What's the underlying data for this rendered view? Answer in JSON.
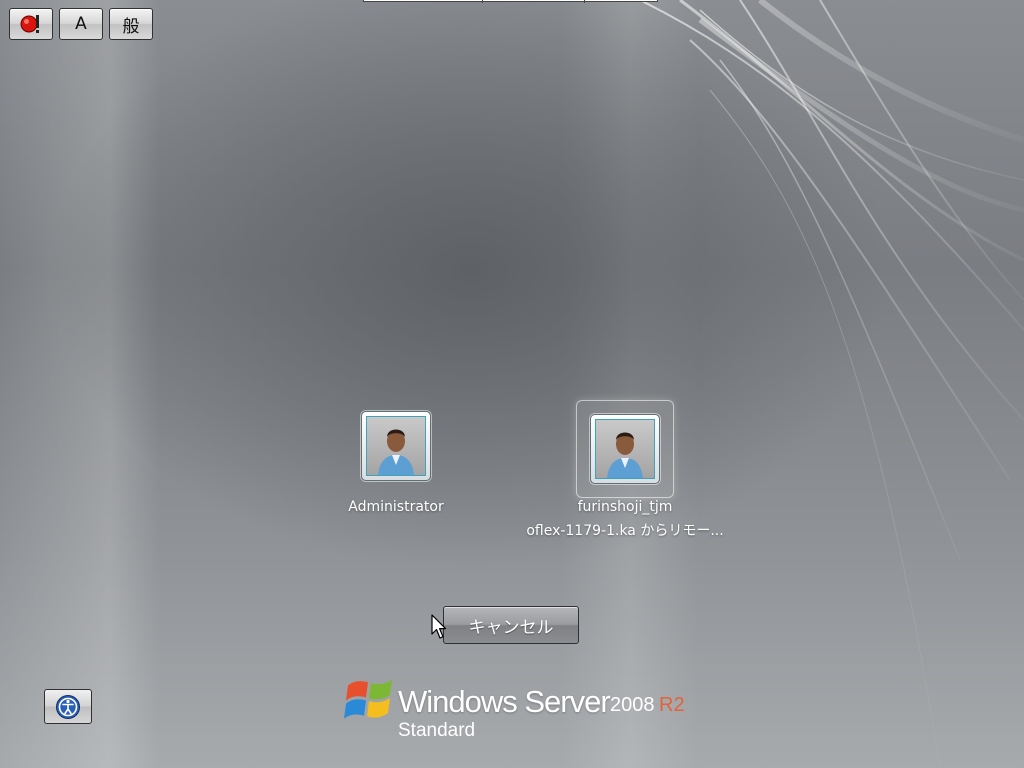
{
  "toolbar": {
    "buttons": [
      {
        "name": "input-indicator",
        "icon": "ime-indicator-icon"
      },
      {
        "name": "input-mode",
        "label": "A"
      },
      {
        "name": "conversion-mode",
        "label": "般"
      }
    ]
  },
  "users": [
    {
      "name": "Administrator",
      "sub": "",
      "selected": false
    },
    {
      "name": "furinshoji_tjm",
      "sub": "oflex-1179-1.ka からリモー...",
      "selected": true
    }
  ],
  "cancel_label": "キャンセル",
  "ease_of_access_icon": "ease-of-access-icon",
  "branding": {
    "product": "Windows Server",
    "version": "2008",
    "release": "R2",
    "edition": "Standard"
  },
  "colors": {
    "r2_accent": "#e0643a",
    "frame_accent": "#3fa3b9"
  }
}
